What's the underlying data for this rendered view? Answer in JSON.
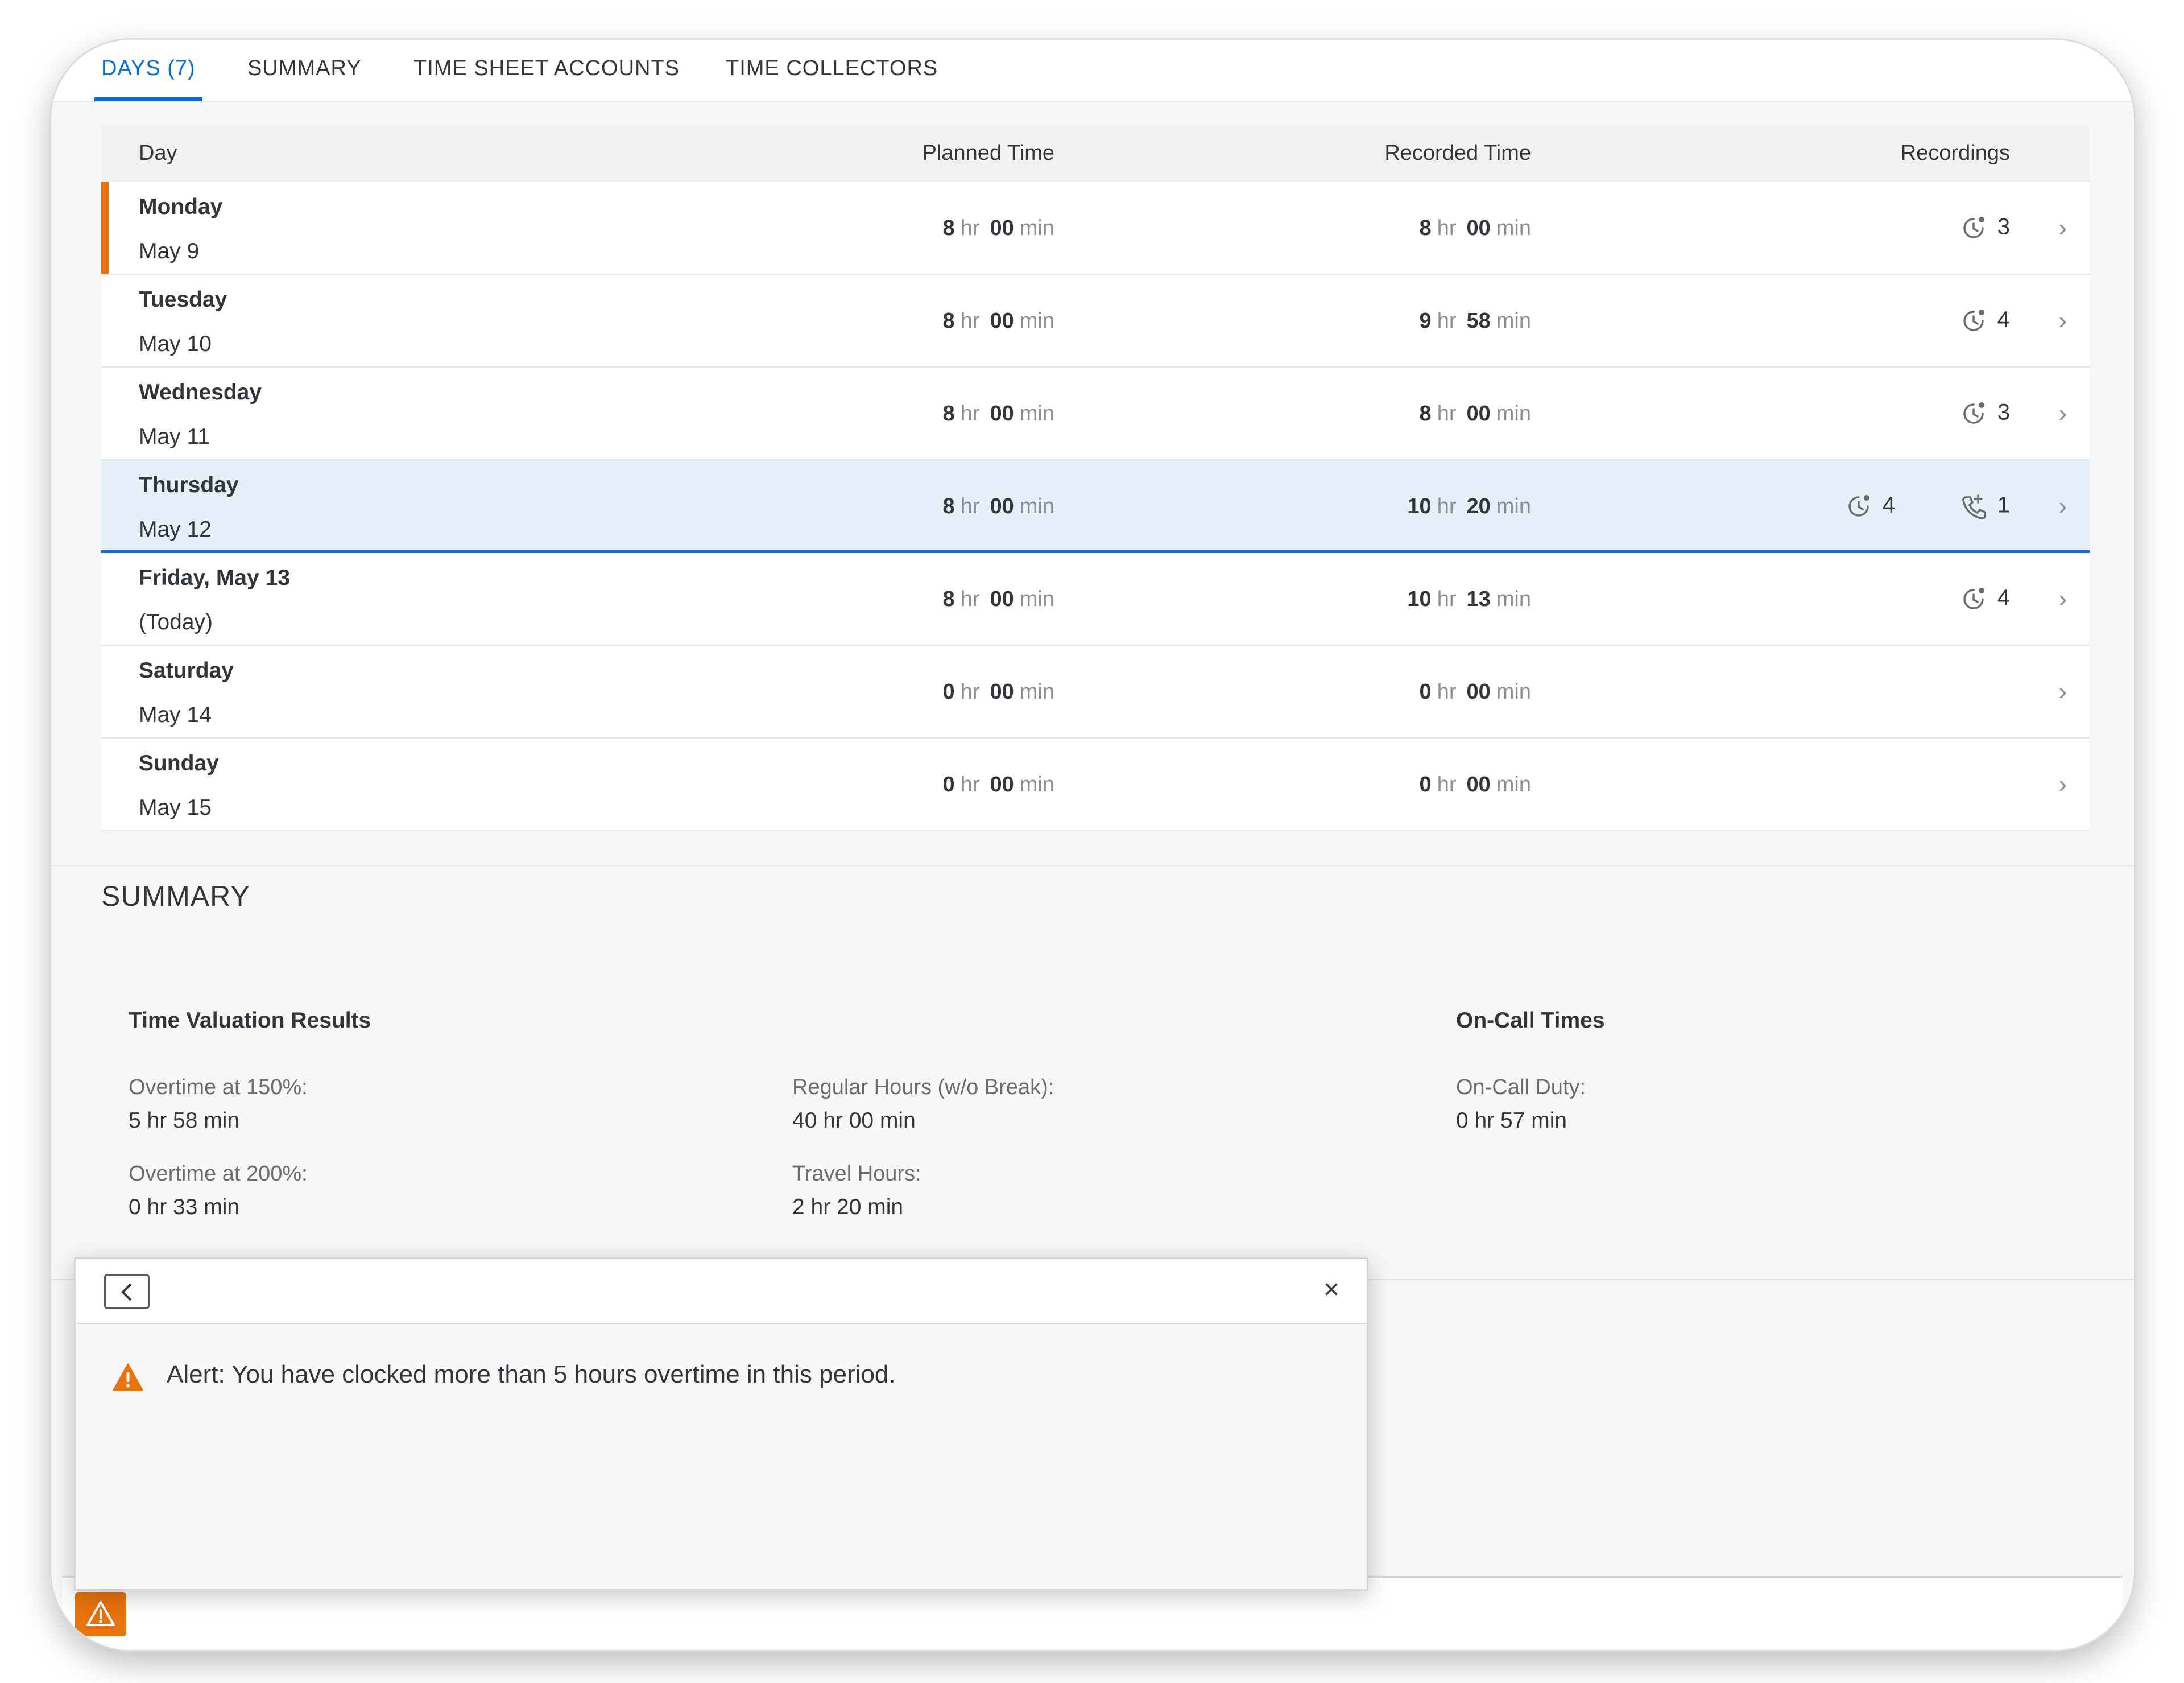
{
  "tabs": [
    {
      "label": "DAYS (7)",
      "active": true
    },
    {
      "label": "SUMMARY",
      "active": false
    },
    {
      "label": "TIME SHEET ACCOUNTS",
      "active": false
    },
    {
      "label": "TIME COLLECTORS",
      "active": false
    }
  ],
  "table": {
    "headers": {
      "day": "Day",
      "planned": "Planned Time",
      "recorded": "Recorded Time",
      "recordings": "Recordings"
    },
    "units": {
      "hr": "hr",
      "min": "min"
    },
    "rows": [
      {
        "name": "Monday",
        "date": "May 9",
        "planned_hr": "8",
        "planned_min": "00",
        "recorded_hr": "8",
        "recorded_min": "00",
        "clock_count": "3",
        "oncall_count": ""
      },
      {
        "name": "Tuesday",
        "date": "May 10",
        "planned_hr": "8",
        "planned_min": "00",
        "recorded_hr": "9",
        "recorded_min": "58",
        "clock_count": "4",
        "oncall_count": ""
      },
      {
        "name": "Wednesday",
        "date": "May 11",
        "planned_hr": "8",
        "planned_min": "00",
        "recorded_hr": "8",
        "recorded_min": "00",
        "clock_count": "3",
        "oncall_count": ""
      },
      {
        "name": "Thursday",
        "date": "May 12",
        "planned_hr": "8",
        "planned_min": "00",
        "recorded_hr": "10",
        "recorded_min": "20",
        "clock_count": "4",
        "oncall_count": "1"
      },
      {
        "name": "Friday, May 13",
        "date": "(Today)",
        "planned_hr": "8",
        "planned_min": "00",
        "recorded_hr": "10",
        "recorded_min": "13",
        "clock_count": "4",
        "oncall_count": ""
      },
      {
        "name": "Saturday",
        "date": "May 14",
        "planned_hr": "0",
        "planned_min": "00",
        "recorded_hr": "0",
        "recorded_min": "00",
        "clock_count": "",
        "oncall_count": ""
      },
      {
        "name": "Sunday",
        "date": "May 15",
        "planned_hr": "0",
        "planned_min": "00",
        "recorded_hr": "0",
        "recorded_min": "00",
        "clock_count": "",
        "oncall_count": ""
      }
    ]
  },
  "summary": {
    "title": "SUMMARY",
    "time_valuation_title": "Time Valuation Results",
    "on_call_title": "On-Call Times",
    "overtime150_label": "Overtime at 150%:",
    "overtime150_value": "5 hr 58 min",
    "overtime200_label": "Overtime at 200%:",
    "overtime200_value": "0 hr 33 min",
    "regular_label": "Regular Hours (w/o Break):",
    "regular_value": "40 hr 00 min",
    "travel_label": "Travel Hours:",
    "travel_value": "2 hr 20 min",
    "oncall_label": "On-Call Duty:",
    "oncall_value": "0 hr 57 min"
  },
  "popover": {
    "close_symbol": "×",
    "alert_text": "Alert: You have clocked more than 5 hours overtime in this period."
  },
  "colors": {
    "accent": "#0a6ed1",
    "warning": "#e9730c",
    "selected_row": "#e5f0fa"
  }
}
